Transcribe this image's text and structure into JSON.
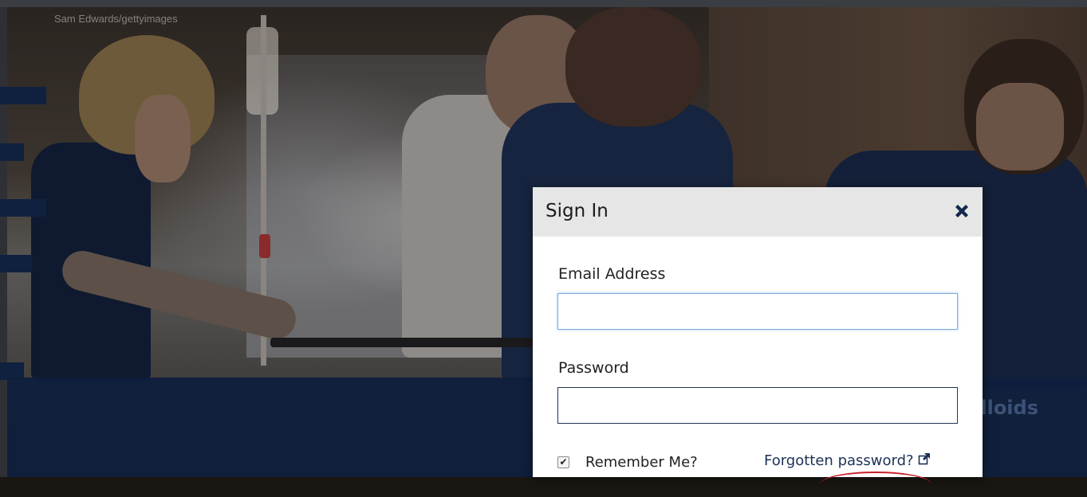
{
  "hero": {
    "photo_credit": "Sam Edwards/gettyimages",
    "banner_partial_title": "lloids"
  },
  "modal": {
    "title": "Sign In",
    "close_icon": "close-icon",
    "email_label": "Email Address",
    "email_value": "",
    "password_label": "Password",
    "password_value": "",
    "remember_label": "Remember Me?",
    "remember_checked": true,
    "forgot_label": "Forgotten password?",
    "forgot_icon": "external-link-icon"
  },
  "colors": {
    "navy": "#0f213f",
    "modal_header": "#e6e6e6",
    "focus_border": "#7aaee0",
    "link": "#1c3255"
  }
}
